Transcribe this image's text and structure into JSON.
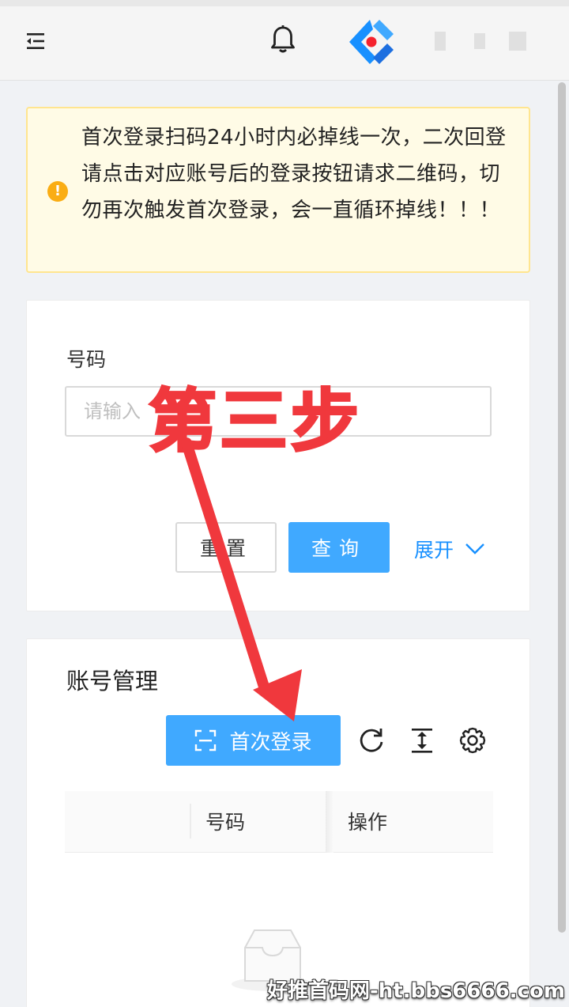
{
  "topbar": {
    "menu_icon": "menu-fold-icon",
    "bell_icon": "bell-icon",
    "logo_icon": "app-logo"
  },
  "alert": {
    "icon": "exclamation-circle-icon",
    "color": "#faad14",
    "text": "首次登录扫码24小时内必掉线一次，二次回登请点击对应账号后的登录按钮请求二维码，切勿再次触发首次登录，会一直循环掉线！！！"
  },
  "search": {
    "label": "号码",
    "placeholder": "请输入",
    "value": "",
    "reset_label": "重置",
    "query_label": "查询",
    "expand_label": "展开"
  },
  "accounts": {
    "title": "账号管理",
    "first_login_label": "首次登录",
    "first_login_icon": "scan-icon",
    "toolbar_icons": [
      "reload-icon",
      "column-height-icon",
      "setting-icon"
    ],
    "columns": [
      "号码",
      "操作"
    ],
    "rows": []
  },
  "annotation": {
    "step_text": "第三步",
    "color": "#f0383d"
  },
  "watermark": "好推首码网-ht.bbs6666.com",
  "colors": {
    "primary": "#40a9ff",
    "link": "#1890ff",
    "alert_bg": "#fffbe6"
  }
}
